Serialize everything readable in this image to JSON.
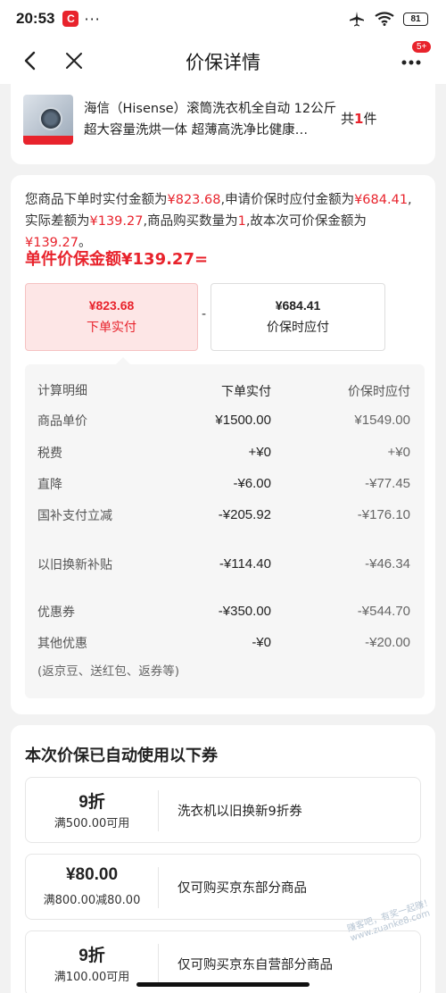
{
  "status_bar": {
    "time": "20:53",
    "app_badge": "C",
    "dots": "···",
    "battery": "81"
  },
  "nav": {
    "title": "价保详情",
    "more_badge": "5+"
  },
  "product": {
    "name": "海信（Hisense）滚筒洗衣机全自动 12公斤超大容量洗烘一体 超薄高洗净比健康…",
    "qty_prefix": "共",
    "qty": "1",
    "qty_suffix": "件"
  },
  "summary": {
    "p1": "您商品下单时实付金额为",
    "paid": "¥823.68",
    "p2": ",申请价保时应付金额为",
    "due": "¥684.41",
    "p3": ",实际差额为",
    "diff": "¥139.27",
    "p4": ",商品购买数量为",
    "qty": "1",
    "p5": ",故本次可价保金额为",
    "refund": "¥139.27",
    "p6": "。"
  },
  "unit_amount": "单件价保金额¥139.27=",
  "compare": {
    "pay_amount": "¥823.68",
    "pay_label": "下单实付",
    "minus": "-",
    "due_amount": "¥684.41",
    "due_label": "价保时应付"
  },
  "calc": {
    "headers": [
      "计算明细",
      "下单实付",
      "价保时应付"
    ],
    "rows": [
      {
        "label": "商品单价",
        "paid": "¥1500.00",
        "due": "¥1549.00"
      },
      {
        "label": "税费",
        "paid": "+¥0",
        "due": "+¥0"
      },
      {
        "label": "直降",
        "paid": "-¥6.00",
        "due": "-¥77.45"
      },
      {
        "label": "国补支付立减",
        "paid": "-¥205.92",
        "due": "-¥176.10"
      },
      {
        "label": "以旧换新补贴",
        "paid": "-¥114.40",
        "due": "-¥46.34"
      },
      {
        "label": "优惠券",
        "paid": "-¥350.00",
        "due": "-¥544.70"
      },
      {
        "label": "其他优惠",
        "paid": "-¥0",
        "due": "-¥20.00"
      }
    ],
    "note": "(返京豆、送红包、返券等)"
  },
  "coupons": {
    "title": "本次价保已自动使用以下券",
    "items": [
      {
        "value": "9折",
        "condition": "满500.00可用",
        "description": "洗衣机以旧换新9折券"
      },
      {
        "value": "¥80.00",
        "condition": "满800.00减80.00",
        "description": "仅可购买京东部分商品"
      },
      {
        "value": "9折",
        "condition": "满100.00可用",
        "description": "仅可购买京东自营部分商品"
      }
    ]
  },
  "watermark": "赚客吧，有奖一起赚！ www.zuanke8.com",
  "colors": {
    "accent": "#e8232c",
    "pay_box_bg": "#fde6e6"
  }
}
